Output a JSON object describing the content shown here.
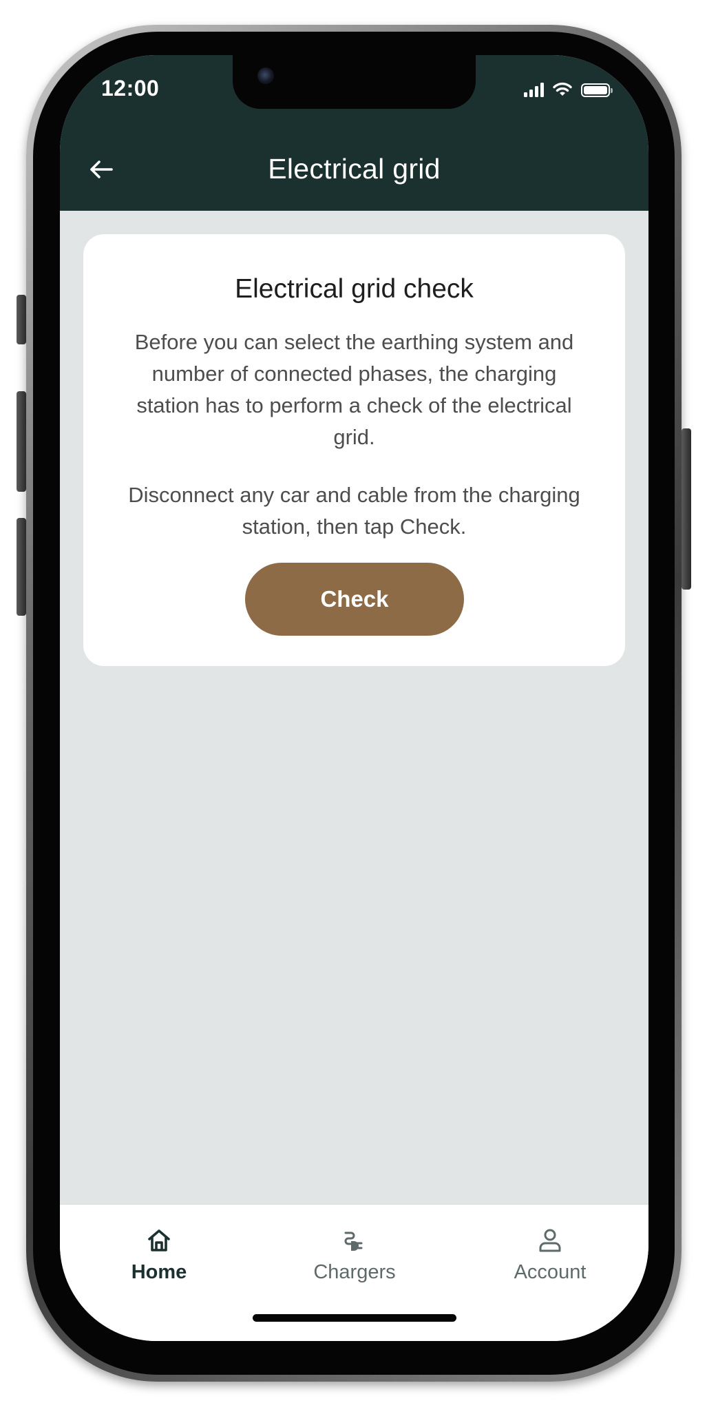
{
  "status_bar": {
    "time": "12:00",
    "icons": [
      "signal-icon",
      "wifi-icon",
      "battery-icon"
    ]
  },
  "header": {
    "title": "Electrical grid",
    "back_icon": "arrow-left-icon",
    "background": "#1b312f"
  },
  "card": {
    "title": "Electrical grid check",
    "paragraph1": "Before you can select the earthing system and number of connected phases, the charging station has to perform a check of the electrical grid.",
    "paragraph2": "Disconnect any car and cable from the charging station, then tap Check.",
    "button_label": "Check",
    "button_color": "#8d6b47"
  },
  "bottom_nav": {
    "items": [
      {
        "label": "Home",
        "icon": "home-icon",
        "active": true
      },
      {
        "label": "Chargers",
        "icon": "charger-plug-icon",
        "active": false
      },
      {
        "label": "Account",
        "icon": "user-icon",
        "active": false
      }
    ]
  },
  "colors": {
    "screen_background": "#e1e5e5",
    "nav_active": "#1b312f",
    "nav_inactive": "#5e6a69"
  }
}
